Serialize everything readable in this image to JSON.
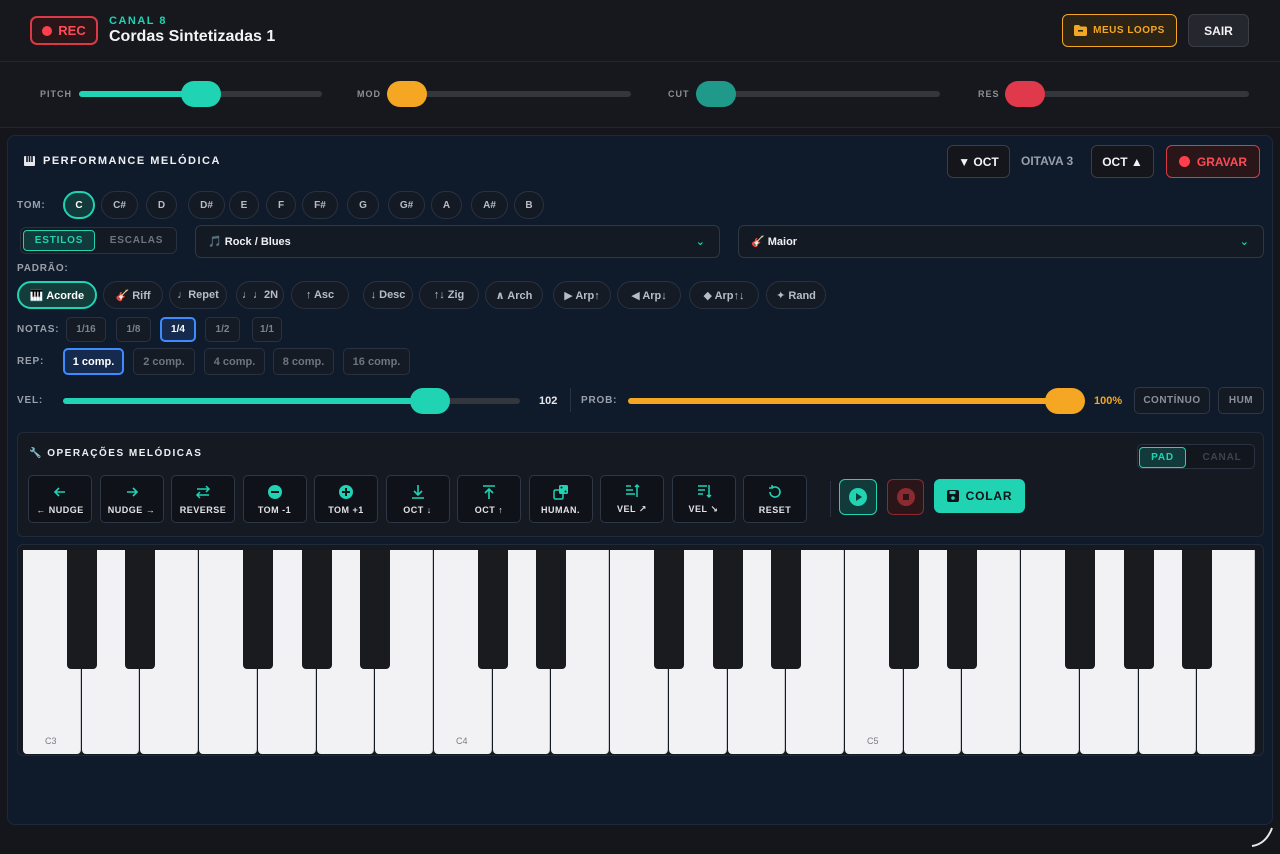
{
  "topbar": {
    "rec_label": "REC",
    "channel_label": "CANAL 8",
    "channel_name": "Cordas Sintetizadas 1",
    "loops_label": "MEUS LOOPS",
    "exit_label": "SAIR"
  },
  "sliders": {
    "pitch": {
      "label": "PITCH",
      "value": 0.5,
      "color": "#1fd3b3"
    },
    "mod": {
      "label": "MOD",
      "value": 0.0,
      "color": "#f5a623"
    },
    "cut": {
      "label": "CUT",
      "value": 0.0,
      "color": "#1f9a8a"
    },
    "res": {
      "label": "RES",
      "value": 0.0,
      "color": "#e0394b"
    }
  },
  "panel": {
    "title": "PERFORMANCE MELÓDICA",
    "oct_down_label": "▼ OCT",
    "octave_label": "OITAVA 3",
    "oct_up_label": "OCT ▲",
    "record_label": "GRAVAR"
  },
  "tom": {
    "label": "TOM:",
    "keys": [
      "C",
      "C#",
      "D",
      "D#",
      "E",
      "F",
      "F#",
      "G",
      "G#",
      "A",
      "A#",
      "B"
    ],
    "selected": "C"
  },
  "mode": {
    "styles_label": "ESTILOS",
    "scales_label": "ESCALAS",
    "selected": "ESTILOS"
  },
  "style_select": {
    "value": "🎵 Rock / Blues"
  },
  "scale_select": {
    "value": "🎸 Maior"
  },
  "pattern": {
    "label": "PADRÃO:",
    "items": [
      "🎹 Acorde",
      "🎸 Riff",
      "♩Repet",
      "♩♩2N",
      "↑ Asc",
      "↓ Desc",
      "↑↓ Zig",
      "∧ Arch",
      "▶ Arp↑",
      "◀ Arp↓",
      "◆ Arp↑↓",
      "✦ Rand"
    ],
    "selected": "🎹 Acorde"
  },
  "notes": {
    "label": "NOTAS:",
    "items": [
      "1/16",
      "1/8",
      "1/4",
      "1/2",
      "1/1"
    ],
    "selected": "1/4"
  },
  "rep": {
    "label": "REP:",
    "items": [
      "1 comp.",
      "2 comp.",
      "4 comp.",
      "8 comp.",
      "16 comp."
    ],
    "selected": "1 comp."
  },
  "velocity": {
    "label": "VEL:",
    "value": 102,
    "value_text": "102",
    "max": 127
  },
  "probability": {
    "label": "PROB:",
    "value": 100,
    "value_text": "100%"
  },
  "continuous_label": "CONTÍNUO",
  "hum_label": "HUM",
  "ops": {
    "title": "OPERAÇÕES MELÓDICAS",
    "pad_label": "PAD",
    "channel_label": "CANAL",
    "buttons": [
      {
        "label": "← NUDGE",
        "icon": "arrow-left-icon"
      },
      {
        "label": "NUDGE →",
        "icon": "arrow-right-icon"
      },
      {
        "label": "REVERSE",
        "icon": "swap-icon"
      },
      {
        "label": "TOM -1",
        "icon": "minus-circle-icon"
      },
      {
        "label": "TOM +1",
        "icon": "plus-circle-icon"
      },
      {
        "label": "OCT ↓",
        "icon": "download-icon"
      },
      {
        "label": "OCT ↑",
        "icon": "upload-icon"
      },
      {
        "label": "HUMAN.",
        "icon": "dice-icon"
      },
      {
        "label": "VEL ↗",
        "icon": "sort-up-icon"
      },
      {
        "label": "VEL ↘",
        "icon": "sort-down-icon"
      },
      {
        "label": "RESET",
        "icon": "reset-icon"
      }
    ],
    "paste_label": "COLAR"
  },
  "piano": {
    "labels": [
      "C3",
      "C4",
      "C5"
    ]
  },
  "colors": {
    "accent": "#1fd3b3",
    "orange": "#f5a623",
    "red": "#e0394b",
    "blue": "#3d8bff"
  }
}
